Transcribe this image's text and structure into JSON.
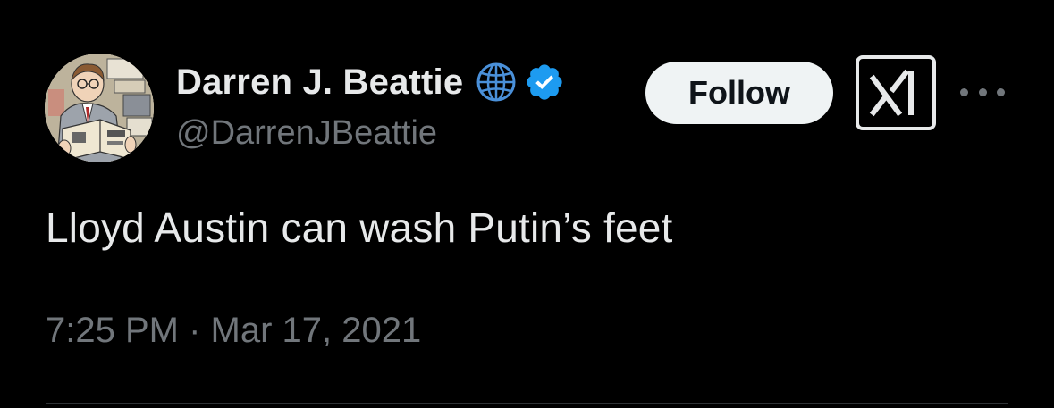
{
  "author": {
    "display_name": "Darren J. Beattie",
    "handle": "@DarrenJBeattie",
    "affiliation_icon": "globe-icon",
    "verified_icon": "verified-badge-icon",
    "verified_color": "#1d9bf0"
  },
  "actions": {
    "follow_label": "Follow",
    "grok_icon": "grok-logo-icon",
    "more_icon": "more-options-icon"
  },
  "tweet": {
    "text": "Lloyd Austin can wash Putin’s feet",
    "timestamp": "7:25 PM · Mar 17, 2021"
  },
  "colors": {
    "background": "#000000",
    "primary_text": "#e7e9ea",
    "secondary_text": "#71767b",
    "follow_button_bg": "#eff3f4",
    "divider": "#2f3336"
  }
}
